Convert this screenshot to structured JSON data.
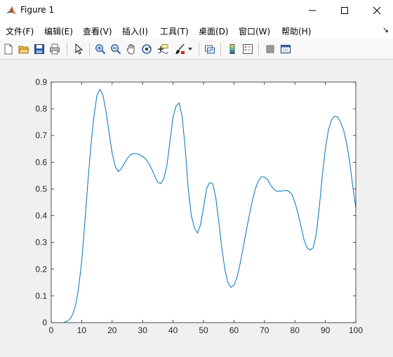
{
  "window": {
    "title": "Figure 1"
  },
  "menu": [
    "文件(F)",
    "编辑(E)",
    "查看(V)",
    "插入(I)",
    "工具(T)",
    "桌面(D)",
    "窗口(W)",
    "帮助(H)"
  ],
  "menu_overflow_glyph": "↘",
  "toolbar": [
    "new-figure-icon",
    "open-file-icon",
    "save-icon",
    "print-icon",
    "select-arrow-icon",
    "zoom-in-icon",
    "zoom-out-icon",
    "pan-hand-icon",
    "rotate-3d-icon",
    "data-cursor-icon",
    "brush-icon",
    "brush-dropdown-icon",
    "link-plot-icon",
    "colorbar-icon",
    "legend-icon",
    "hide-plot-tools-icon",
    "show-plot-tools-icon"
  ],
  "chart_data": {
    "type": "line",
    "title": "",
    "xlabel": "",
    "ylabel": "",
    "xlim": [
      0,
      100
    ],
    "ylim": [
      0,
      0.9
    ],
    "xticks": [
      "0",
      "10",
      "20",
      "30",
      "40",
      "50",
      "60",
      "70",
      "80",
      "90",
      "100"
    ],
    "yticks": [
      "0",
      "0.1",
      "0.2",
      "0.3",
      "0.4",
      "0.5",
      "0.6",
      "0.7",
      "0.8",
      "0.9"
    ],
    "line_color": "#0072BD",
    "grid": false,
    "series": [
      {
        "x": [
          4,
          5,
          6,
          7,
          8,
          9,
          10,
          11,
          12,
          13,
          14,
          15,
          16,
          17,
          18,
          19,
          20,
          21,
          22,
          23,
          24,
          25,
          26,
          27,
          28,
          29,
          30,
          31,
          32,
          33,
          34,
          35,
          36,
          37,
          38,
          39,
          40,
          41,
          42,
          43,
          44,
          45,
          46,
          47,
          48,
          49,
          50,
          51,
          52,
          53,
          54,
          55,
          56,
          57,
          58,
          59,
          60,
          61,
          62,
          63,
          64,
          65,
          66,
          67,
          68,
          69,
          70,
          71,
          72,
          73,
          74,
          75,
          76,
          77,
          78,
          79,
          80,
          81,
          82,
          83,
          84,
          85,
          86,
          87,
          88,
          89,
          90,
          91,
          92,
          93,
          94,
          95,
          96,
          97,
          98,
          99,
          100
        ],
        "y": [
          0,
          0.004,
          0.012,
          0.03,
          0.065,
          0.13,
          0.23,
          0.37,
          0.52,
          0.66,
          0.77,
          0.85,
          0.873,
          0.85,
          0.79,
          0.71,
          0.635,
          0.585,
          0.565,
          0.575,
          0.595,
          0.615,
          0.628,
          0.633,
          0.632,
          0.628,
          0.622,
          0.612,
          0.596,
          0.575,
          0.548,
          0.525,
          0.52,
          0.54,
          0.59,
          0.68,
          0.77,
          0.81,
          0.822,
          0.77,
          0.65,
          0.5,
          0.4,
          0.355,
          0.335,
          0.365,
          0.43,
          0.5,
          0.524,
          0.52,
          0.47,
          0.38,
          0.28,
          0.2,
          0.15,
          0.132,
          0.14,
          0.17,
          0.22,
          0.28,
          0.34,
          0.4,
          0.455,
          0.5,
          0.53,
          0.545,
          0.545,
          0.535,
          0.515,
          0.5,
          0.492,
          0.492,
          0.493,
          0.495,
          0.492,
          0.48,
          0.45,
          0.41,
          0.36,
          0.31,
          0.28,
          0.272,
          0.28,
          0.33,
          0.43,
          0.55,
          0.65,
          0.72,
          0.758,
          0.772,
          0.77,
          0.75,
          0.72,
          0.67,
          0.6,
          0.51,
          0.43
        ]
      }
    ]
  }
}
